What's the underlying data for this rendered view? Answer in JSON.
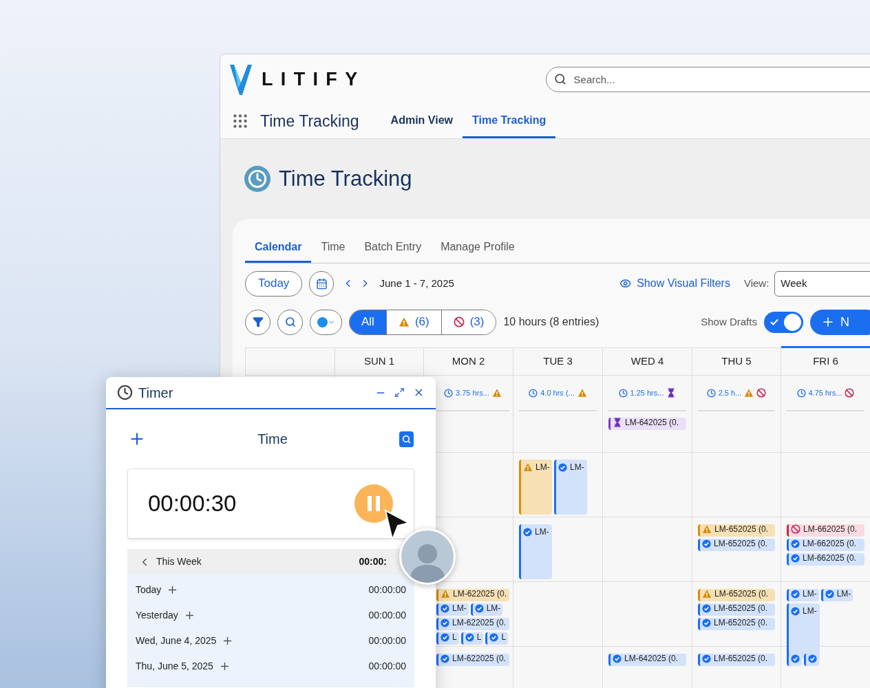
{
  "header": {
    "logo": "LITIFY",
    "search": {
      "placeholder": "Search..."
    }
  },
  "nav": {
    "app_name": "Time Tracking",
    "tabs": [
      {
        "label": "Admin View",
        "selected": false
      },
      {
        "label": "Time Tracking",
        "selected": true
      }
    ]
  },
  "page_title": "Time Tracking",
  "tabs": [
    {
      "label": "Calendar",
      "selected": true
    },
    {
      "label": "Time",
      "selected": false
    },
    {
      "label": "Batch Entry",
      "selected": false
    },
    {
      "label": "Manage Profile",
      "selected": false
    }
  ],
  "toolbar": {
    "today": "Today",
    "range": "June 1 - 7, 2025",
    "visual_filters": "Show Visual Filters",
    "view_label": "View:",
    "view_value": "Week"
  },
  "filters": {
    "segments": [
      {
        "kind": "all",
        "label": "All",
        "selected": true
      },
      {
        "kind": "warning",
        "label": "(6)",
        "selected": false
      },
      {
        "kind": "rejected",
        "label": "(3)",
        "selected": false
      }
    ],
    "summary": "10 hours (8 entries)",
    "drafts_label": "Show Drafts",
    "drafts_on": true,
    "new_button": "N"
  },
  "calendar": {
    "days": [
      {
        "label": "SUN 1",
        "selected": false
      },
      {
        "label": "MON 2",
        "selected": false,
        "summary": "3.75 hrs...",
        "flags": [
          {
            "kind": "warning"
          }
        ]
      },
      {
        "label": "TUE 3",
        "selected": false,
        "summary": "4.0 hrs (...",
        "flags": [
          {
            "kind": "warning"
          }
        ]
      },
      {
        "label": "WED 4",
        "selected": false,
        "summary": "1.25 hrs...",
        "flags": [
          {
            "kind": "pending"
          }
        ]
      },
      {
        "label": "THU 5",
        "selected": false,
        "summary": "2.5 h...",
        "flags": [
          {
            "kind": "warning"
          },
          {
            "kind": "rejected"
          }
        ]
      },
      {
        "label": "FRI 6",
        "selected": true,
        "summary": "4.75 hrs...",
        "flags": [
          {
            "kind": "rejected"
          }
        ]
      }
    ],
    "rows": [
      {
        "cells": [
          [],
          [],
          [],
          [
            {
              "kind": "pending",
              "label": "LM-642025 (0."
            }
          ],
          [],
          []
        ]
      },
      {
        "cells": [
          [],
          [],
          [
            {
              "kind": "warning",
              "label": "LM-",
              "tall": true
            },
            {
              "kind": "approved",
              "label": "LM-",
              "tall": true
            }
          ],
          [],
          [],
          []
        ]
      },
      {
        "cells": [
          [],
          [],
          [
            {
              "kind": "approved",
              "label": "LM-",
              "tall": true
            }
          ],
          [],
          [
            {
              "kind": "warning",
              "label": "LM-652025 (0."
            },
            {
              "kind": "approved",
              "label": "LM-652025 (0."
            }
          ],
          [
            {
              "kind": "rejected",
              "label": "LM-662025 (0."
            },
            {
              "kind": "approved",
              "label": "LM-662025 (0."
            },
            {
              "kind": "approved",
              "label": "LM-662025 (0."
            }
          ]
        ]
      },
      {
        "cells": [
          [],
          [
            {
              "kind": "warning",
              "label": "LM-622025 (0."
            },
            {
              "kind": "approved",
              "label": "LM-"
            },
            {
              "kind": "approved",
              "label": "LM-"
            },
            {
              "kind": "approved",
              "label": "LM-622025 (0."
            },
            {
              "kind": "approved",
              "label": "L"
            },
            {
              "kind": "approved",
              "label": "L"
            },
            {
              "kind": "approved",
              "label": "L"
            }
          ],
          [],
          [],
          [
            {
              "kind": "warning",
              "label": "LM-652025 (0."
            },
            {
              "kind": "approved",
              "label": "LM-652025 (0."
            },
            {
              "kind": "approved",
              "label": "LM-652025 (0."
            }
          ],
          [
            {
              "kind": "approved",
              "label": "LM-"
            },
            {
              "kind": "approved",
              "label": "LM-"
            },
            {
              "kind": "approved",
              "label": "LM-",
              "tall": true
            }
          ]
        ]
      },
      {
        "cells": [
          [],
          [
            {
              "kind": "approved",
              "label": "LM-622025 (0."
            }
          ],
          [],
          [
            {
              "kind": "approved",
              "label": "LM-642025 (0."
            }
          ],
          [
            {
              "kind": "approved",
              "label": "LM-652025 (0."
            }
          ],
          [
            {
              "kind": "approved"
            },
            {
              "kind": "approved"
            }
          ]
        ]
      }
    ]
  },
  "timer": {
    "title": "Timer",
    "heading": "Time",
    "elapsed": "00:00:30",
    "running": true,
    "week": {
      "label": "This Week",
      "total": "00:00:"
    },
    "days": [
      {
        "label": "Today",
        "total": "00:00:00"
      },
      {
        "label": "Yesterday",
        "total": "00:00:00"
      },
      {
        "label": "Wed, June 4, 2025",
        "total": "00:00:00"
      },
      {
        "label": "Thu, June 5, 2025",
        "total": "00:00:00"
      }
    ]
  }
}
